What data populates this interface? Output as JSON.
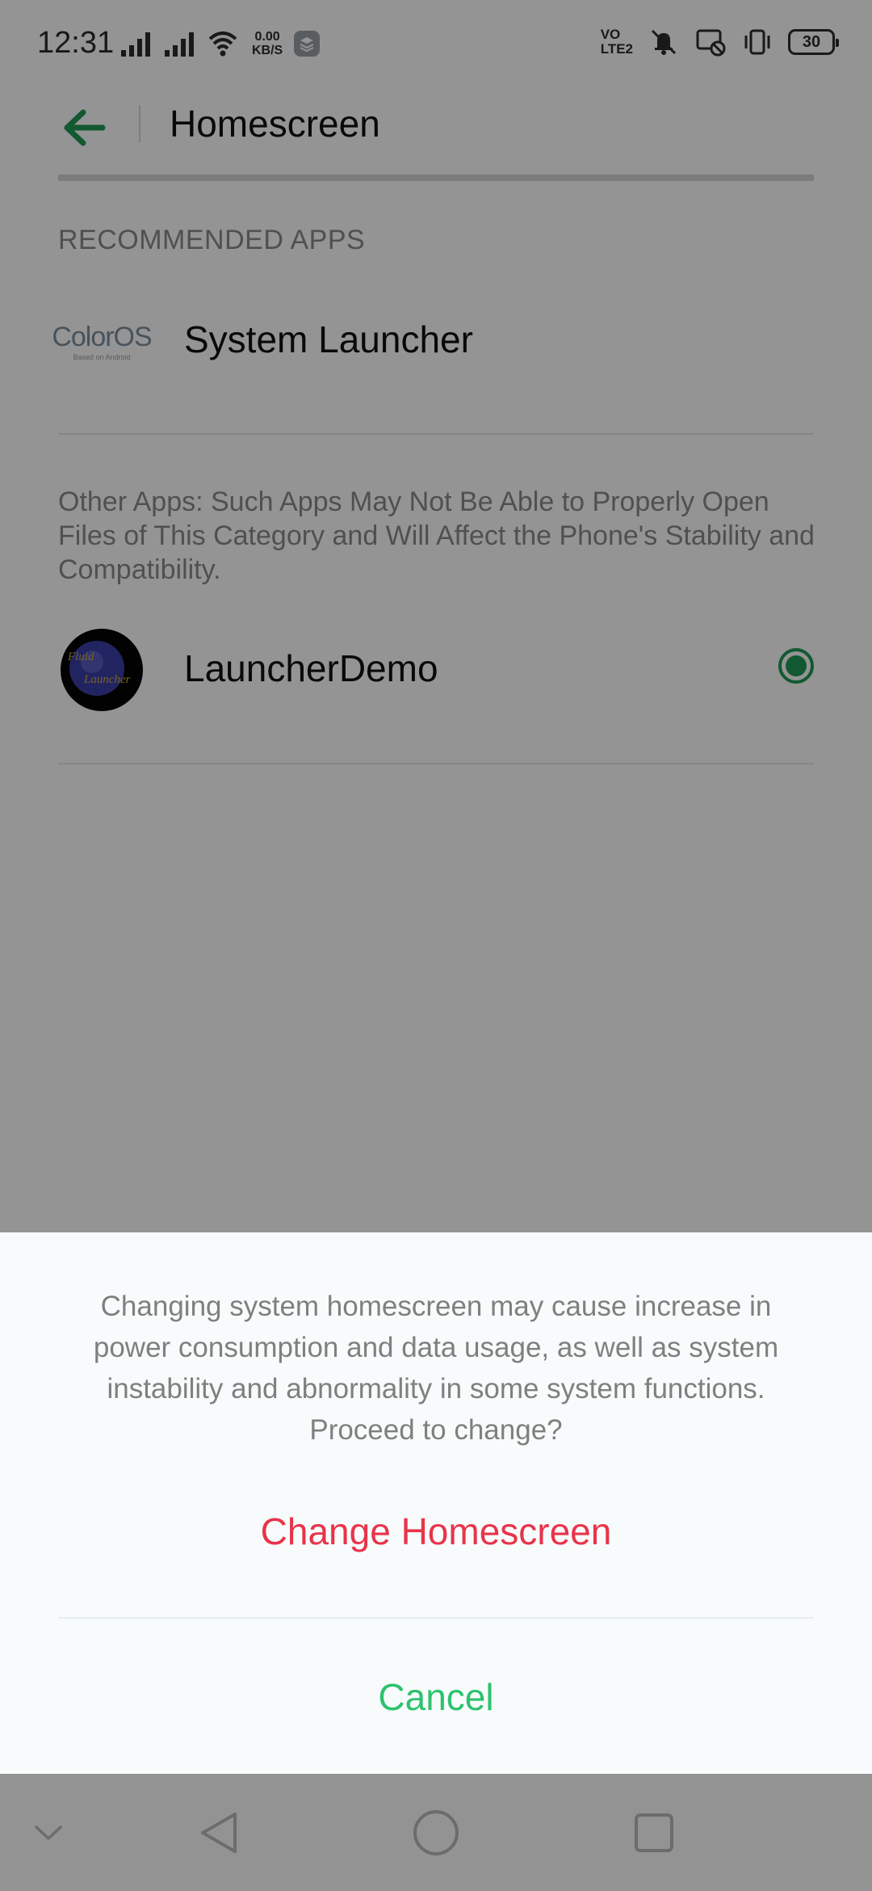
{
  "status_bar": {
    "time": "12:31",
    "net_speed_value": "0.00",
    "net_speed_unit": "KB/S",
    "volte_line1": "VO",
    "volte_line2": "LTE2",
    "battery": "30"
  },
  "header": {
    "title": "Homescreen",
    "accent_color": "#1f9a55"
  },
  "recommended": {
    "section_label": "RECOMMENDED APPS",
    "apps": [
      {
        "name": "System Launcher",
        "logo_text": "ColorOS",
        "logo_tag": "Based on Android"
      }
    ]
  },
  "other": {
    "note": "Other Apps: Such Apps May Not Be Able to Properly Open Files of This Category and Will Affect the Phone's Stability and Compatibility.",
    "apps": [
      {
        "name": "LauncherDemo",
        "icon_text_top": "Fluid",
        "icon_text_bottom": "Launcher",
        "selected": true
      }
    ]
  },
  "dialog": {
    "message": "Changing system homescreen may cause increase in power consumption and data usage, as well as system instability and abnormality in some system functions. Proceed to change?",
    "confirm_label": "Change Homescreen",
    "cancel_label": "Cancel",
    "confirm_color": "#e8344a",
    "cancel_color": "#2dc26e"
  },
  "nav_bar": {
    "items": [
      "chevron-down-icon",
      "back-triangle-icon",
      "home-circle-icon",
      "recents-square-icon"
    ]
  }
}
